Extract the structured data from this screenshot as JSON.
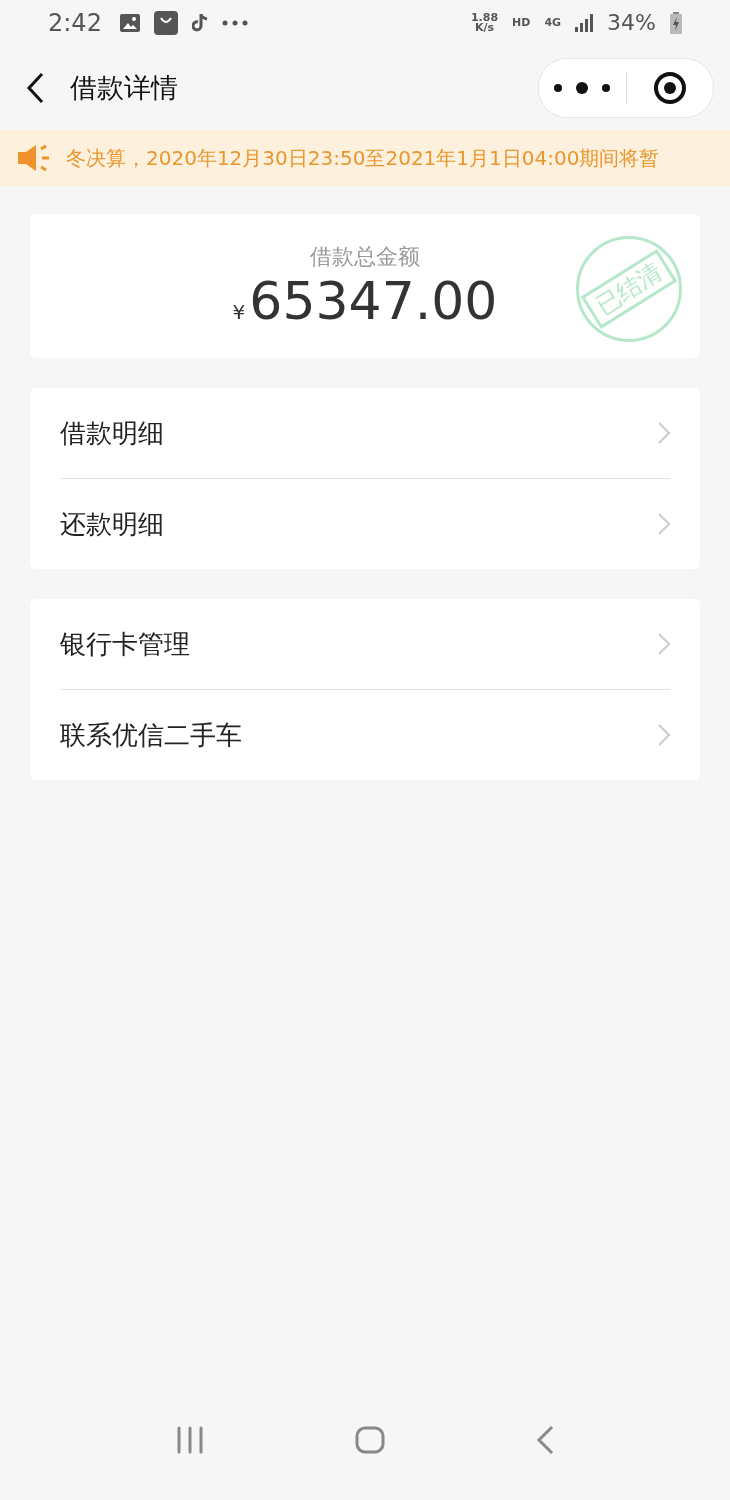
{
  "status_bar": {
    "time": "2:42",
    "speed": "1.88",
    "speed_unit": "K/s",
    "hd": "HD",
    "network": "4G",
    "battery": "34%"
  },
  "header": {
    "title": "借款详情"
  },
  "notice": {
    "text": "冬决算，2020年12月30日23:50至2021年1月1日04:00期间将暂"
  },
  "summary": {
    "label": "借款总金额",
    "currency": "¥",
    "amount": "65347.00",
    "stamp": "已结清"
  },
  "menu_groups": [
    {
      "items": [
        {
          "label": "借款明细"
        },
        {
          "label": "还款明细"
        }
      ]
    },
    {
      "items": [
        {
          "label": "银行卡管理"
        },
        {
          "label": "联系优信二手车"
        }
      ]
    }
  ]
}
